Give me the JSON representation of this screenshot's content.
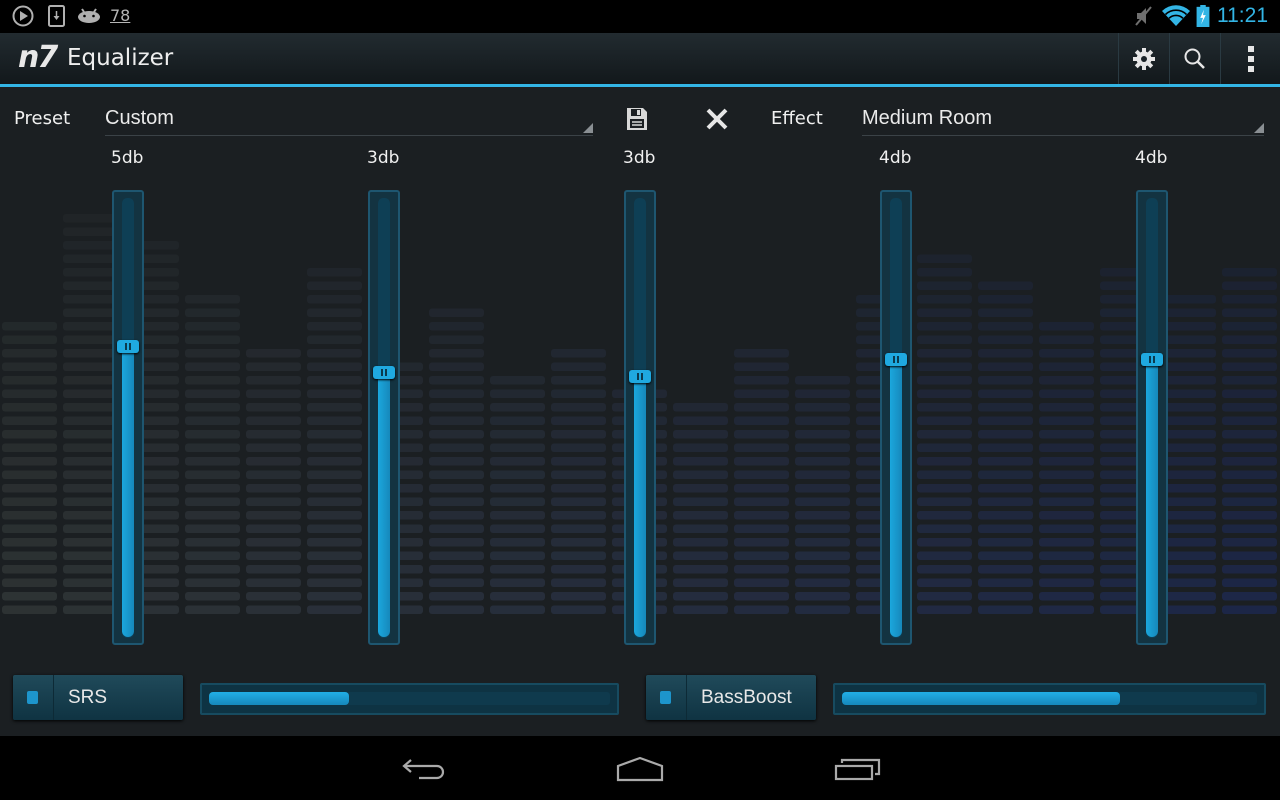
{
  "status_bar": {
    "left_icons": [
      "play-icon",
      "download-icon",
      "android-icon"
    ],
    "notification_count": "78",
    "right_icons": [
      "mute-icon",
      "wifi-icon",
      "battery-charging-icon"
    ],
    "time": "11:21"
  },
  "action_bar": {
    "logo": "n7",
    "title": "Equalizer",
    "actions": [
      "settings-icon",
      "search-icon",
      "overflow-menu-icon"
    ]
  },
  "preset": {
    "label": "Preset",
    "value": "Custom",
    "save_icon": "save-icon",
    "delete_icon": "close-icon"
  },
  "effect": {
    "label": "Effect",
    "value": "Medium Room"
  },
  "bands": [
    {
      "label": "5db",
      "level": 0.66
    },
    {
      "label": "3db",
      "level": 0.6
    },
    {
      "label": "3db",
      "level": 0.59
    },
    {
      "label": "4db",
      "level": 0.63
    },
    {
      "label": "4db",
      "level": 0.63
    }
  ],
  "srs": {
    "label": "SRS",
    "enabled": true,
    "level": 0.35
  },
  "bassboost": {
    "label": "BassBoost",
    "enabled": true,
    "level": 0.67
  },
  "nav_bar": {
    "buttons": [
      "back-icon",
      "home-icon",
      "recents-icon"
    ]
  },
  "colors": {
    "accent": "#33b5e5",
    "slider_fill": "#1ba7dd",
    "background": "#1b1f22"
  }
}
